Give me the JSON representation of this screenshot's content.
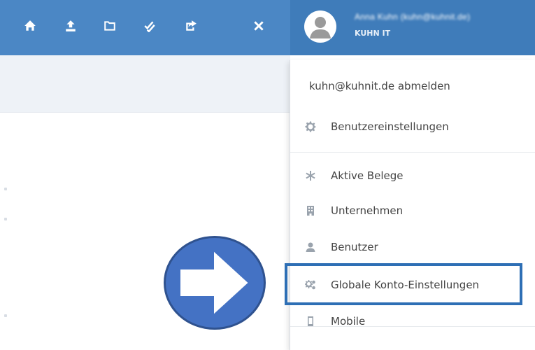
{
  "toolbar": {
    "buttons": [
      {
        "icon": "home-icon"
      },
      {
        "icon": "upload-icon"
      },
      {
        "icon": "folder-icon"
      },
      {
        "icon": "double-check-icon"
      },
      {
        "icon": "share-icon"
      },
      {
        "icon": "close-icon"
      }
    ]
  },
  "user": {
    "name": "Anna Kuhn (kuhn@kuhnit.de)",
    "company": "KUHN IT",
    "avatar_icon": "user-avatar-icon"
  },
  "menu": {
    "logout_label": "kuhn@kuhnit.de abmelden",
    "items": [
      {
        "label": "Benutzereinstellungen",
        "icon": "gear-icon"
      },
      {
        "label": "Aktive Belege",
        "icon": "asterisk-icon"
      },
      {
        "label": "Unternehmen",
        "icon": "building-icon"
      },
      {
        "label": "Benutzer",
        "icon": "person-icon"
      },
      {
        "label": "Globale Konto-Einstellungen",
        "icon": "gears-icon"
      },
      {
        "label": "Mobile",
        "icon": "mobile-icon"
      }
    ]
  },
  "colors": {
    "topbar": "#4b87c5",
    "user_area": "#3f7cba",
    "highlight": "#2e6fb5",
    "arrow_fill": "#4472c4"
  },
  "annotation": {
    "arrow_icon": "right-arrow-icon"
  }
}
